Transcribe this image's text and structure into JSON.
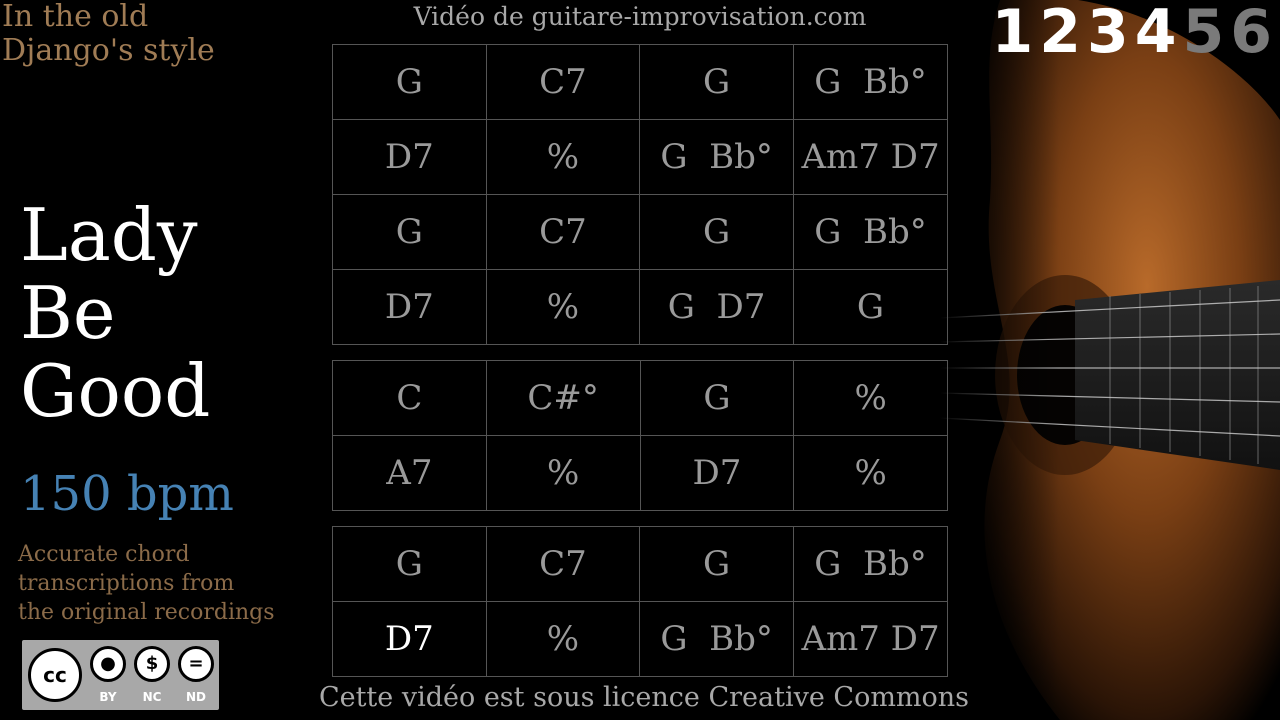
{
  "subtitle": "In the old\nDjango's style",
  "song_title": "Lady\nBe\nGood",
  "tempo": "150 bpm",
  "description": "Accurate chord\ntranscriptions from\nthe original recordings",
  "website": "Vidéo de guitare-improvisation.com",
  "license_text": "Cette vidéo est sous licence Creative Commons",
  "license_badge": {
    "main": "cc",
    "labels": [
      "BY",
      "NC",
      "ND"
    ]
  },
  "beat_counter": {
    "beats": [
      "1",
      "2",
      "3",
      "4",
      "5",
      "6"
    ],
    "current": 4
  },
  "colors": {
    "title": "#ffffff",
    "subtitle": "#a07c55",
    "tempo": "#4682b4",
    "chord": "#9a9a9a",
    "active_chord": "#ffffff"
  },
  "sections": [
    {
      "rows": [
        [
          "G",
          "C7",
          "G",
          "G  Bb°"
        ],
        [
          "D7",
          "%",
          "G  Bb°",
          "Am7 D7"
        ],
        [
          "G",
          "C7",
          "G",
          "G  Bb°"
        ],
        [
          "D7",
          "%",
          "G  D7",
          "G"
        ]
      ]
    },
    {
      "rows": [
        [
          "C",
          "C#°",
          "G",
          "%"
        ],
        [
          "A7",
          "%",
          "D7",
          "%"
        ]
      ]
    },
    {
      "rows": [
        [
          "G",
          "C7",
          "G",
          "G  Bb°"
        ],
        [
          "D7",
          "%",
          "G  Bb°",
          "Am7 D7"
        ]
      ]
    }
  ],
  "active_cell": {
    "section": 2,
    "row": 1,
    "col": 0
  }
}
